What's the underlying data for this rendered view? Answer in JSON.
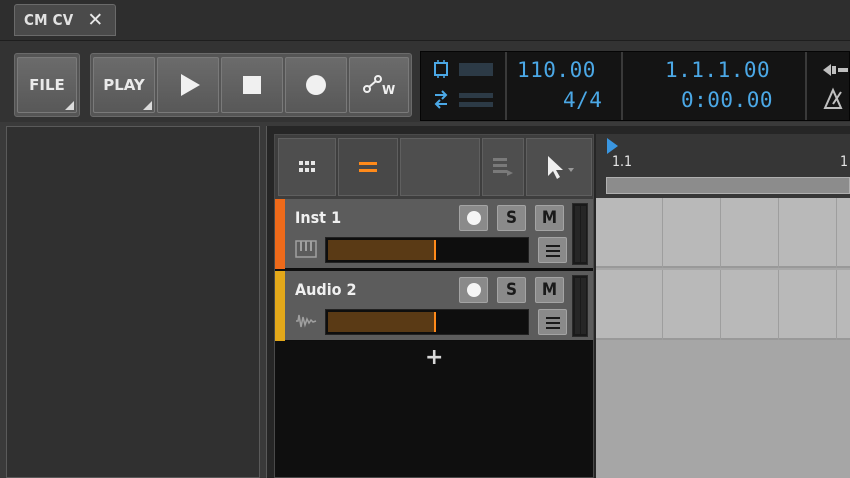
{
  "tab": {
    "title": "CM CV",
    "close": "✕"
  },
  "transport": {
    "file_label": "FILE",
    "play_menu_label": "PLAY",
    "tempo": "110.00",
    "time_signature": "4/4",
    "position_bars": "1.1.1.00",
    "position_time": "0:00.00"
  },
  "tracks": [
    {
      "name": "Inst 1",
      "solo": "S",
      "mute": "M",
      "color": "#ee6a1a"
    },
    {
      "name": "Audio 2",
      "solo": "S",
      "mute": "M",
      "color": "#e3a81a"
    }
  ],
  "add_track": "+",
  "ruler": {
    "marker_1": "1.1",
    "marker_2": "1"
  },
  "colors": {
    "accent_blue": "#4ba8e6",
    "meter_orange": "#ff8a1a"
  }
}
